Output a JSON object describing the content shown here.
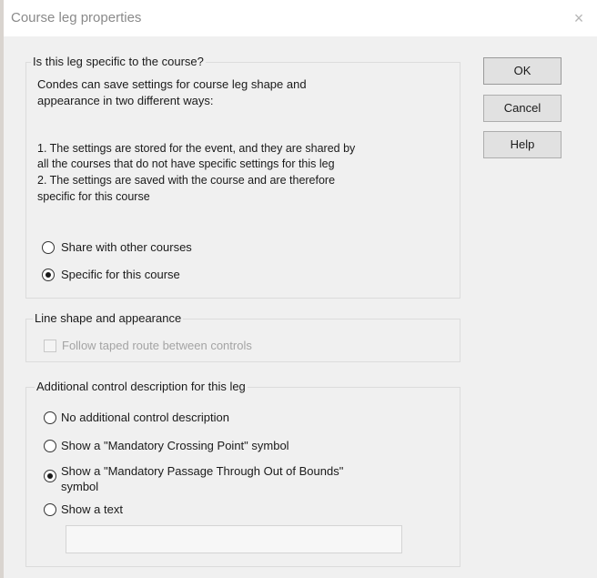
{
  "window": {
    "title": "Course leg properties",
    "close_glyph": "×"
  },
  "buttons": {
    "ok": "OK",
    "cancel": "Cancel",
    "help": "Help"
  },
  "leg_specific": {
    "heading": "Is this leg specific to the course?",
    "intro_line1": "Condes can save settings for course leg shape and",
    "intro_line2": "appearance in two different ways:",
    "item1_line1": "1. The settings are stored for the event, and they are shared by",
    "item1_line2": "all the courses that do not have specific settings for this leg",
    "item2_line1": "2. The settings are saved with the course and are therefore",
    "item2_line2": "specific for this course",
    "options": [
      {
        "label": "Share with other courses",
        "checked": false
      },
      {
        "label": "Specific for this course",
        "checked": true
      }
    ]
  },
  "line_shape": {
    "heading": "Line shape and appearance",
    "follow_taped": {
      "label": "Follow taped route between controls",
      "checked": false,
      "enabled": false
    }
  },
  "additional": {
    "heading": "Additional control description for this leg",
    "options": [
      {
        "label": "No additional control description",
        "checked": false
      },
      {
        "label": "Show a \"Mandatory Crossing Point\" symbol",
        "checked": false
      },
      {
        "label": "Show a \"Mandatory Passage Through Out of Bounds\"",
        "label2": "symbol",
        "checked": true
      },
      {
        "label": "Show a text",
        "checked": false
      }
    ],
    "text_value": ""
  }
}
